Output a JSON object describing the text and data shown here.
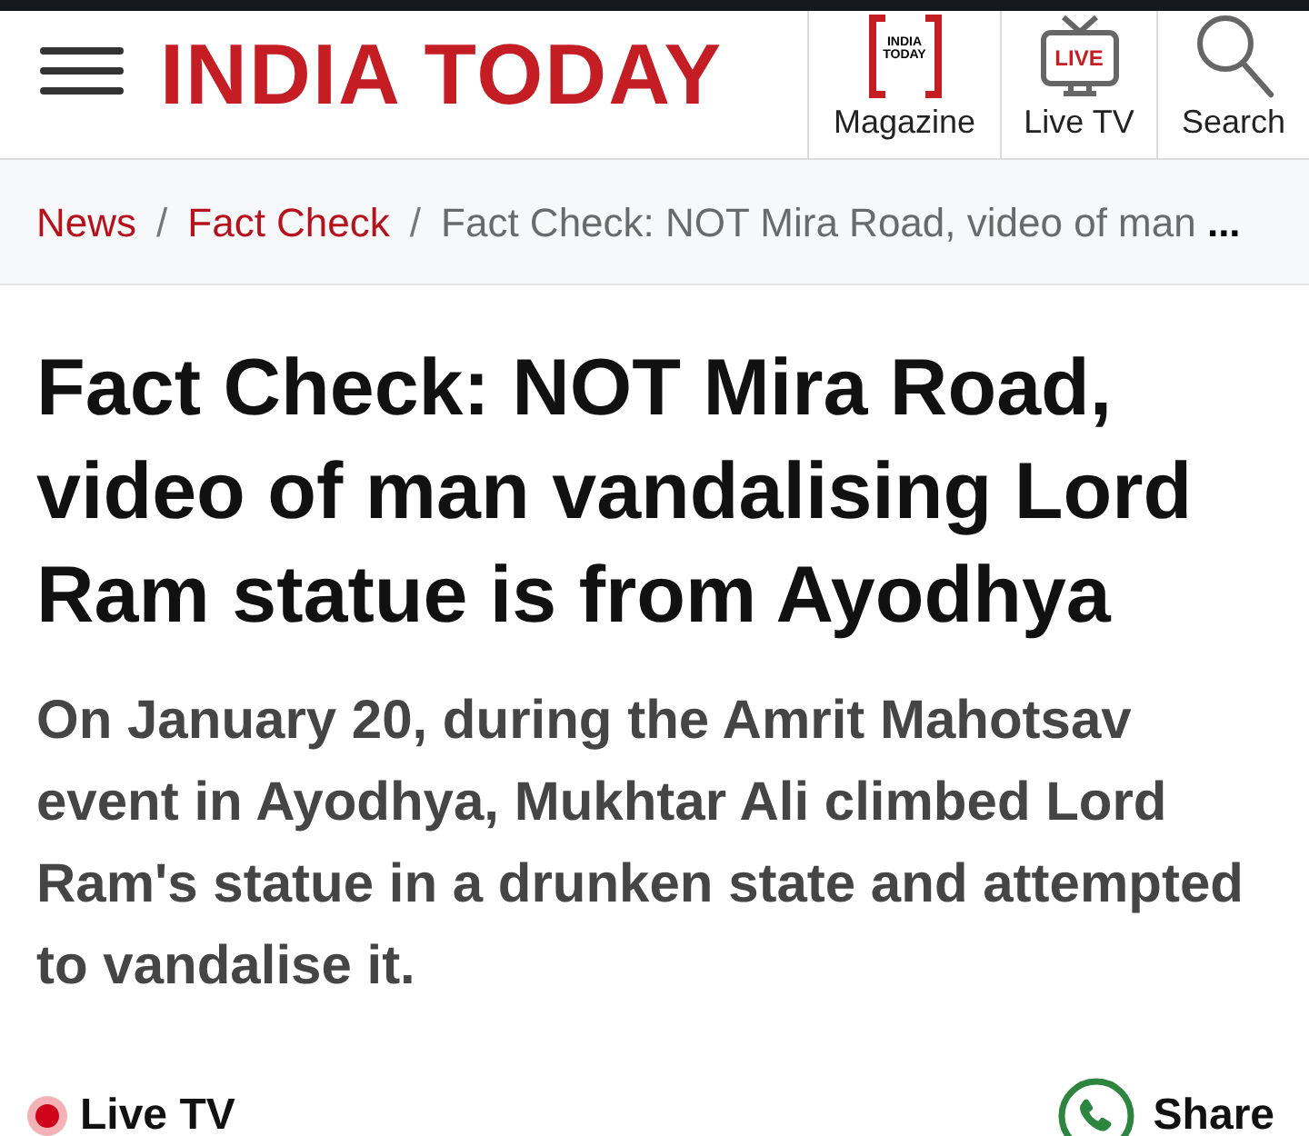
{
  "header": {
    "logo": "INDIA TODAY",
    "nav": [
      {
        "kind": "magazine",
        "label": "Magazine",
        "icon_text": "INDIA TODAY"
      },
      {
        "kind": "live_tv",
        "label": "Live TV",
        "icon_text": "LIVE"
      },
      {
        "kind": "search",
        "label": "Search"
      }
    ]
  },
  "breadcrumb": [
    {
      "label": "News",
      "current": false
    },
    {
      "separator": "/",
      "label": "Fact Check",
      "current": false
    },
    {
      "separator": "/",
      "label": "Fact Check: NOT Mira Road, video of man **...**",
      "current": true
    }
  ],
  "article": {
    "headline": "Fact Check: NOT Mira Road, video of man vandalising Lord Ram statue is from Ayodhya",
    "summary": "On January 20, during the Amrit Mahotsav event in Ayodhya, Mukhtar Ali climbed Lord Ram's statue in a drunken state and attempted to vandalise it."
  },
  "bottom_bar": {
    "live_button": {
      "label": "Live TV"
    },
    "share_button": {
      "label": "Share"
    }
  }
}
